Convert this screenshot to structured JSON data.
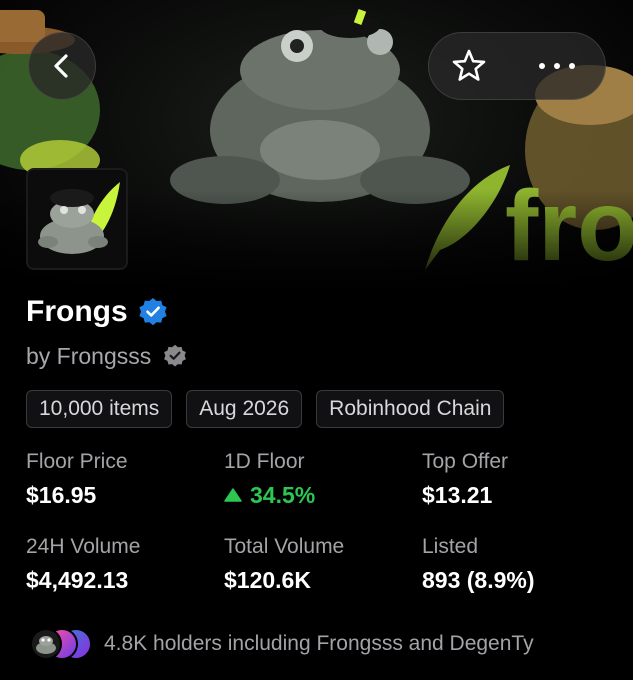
{
  "header": {
    "back_icon": "chevron-left-icon",
    "favorite_icon": "star-outline-icon",
    "more_icon": "more-horizontal-icon",
    "banner_text": "fro"
  },
  "collection": {
    "name": "Frongs",
    "verified_icon": "verified-badge-icon",
    "creator": "by Frongsss",
    "creator_verified_icon": "verified-badge-gray-icon"
  },
  "chips": [
    {
      "label": "10,000 items"
    },
    {
      "label": "Aug 2026"
    },
    {
      "label": "Robinhood Chain"
    }
  ],
  "stats": [
    {
      "label": "Floor Price",
      "value": "$16.95"
    },
    {
      "label": "1D Floor",
      "value": "34.5%",
      "trend": "up",
      "trend_icon": "triangle-up-icon"
    },
    {
      "label": "Top Offer",
      "value": "$13.21"
    },
    {
      "label": "24H Volume",
      "value": "$4,492.13"
    },
    {
      "label": "Total Volume",
      "value": "$120.6K"
    },
    {
      "label": "Listed",
      "value": "893 (8.9%)"
    }
  ],
  "holders": {
    "text": "4.8K holders including Frongsss and DegenTy"
  },
  "colors": {
    "background": "#000000",
    "accent_green": "#2dc653",
    "verified_blue": "#2081e2",
    "muted_text": "#a3a3a8",
    "brand_green": "#c8f53b"
  }
}
